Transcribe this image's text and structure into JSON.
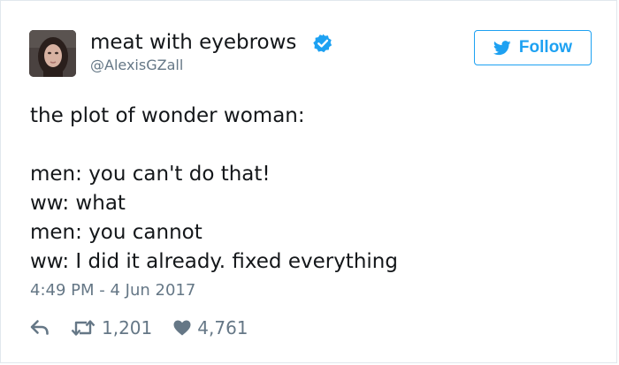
{
  "tweet": {
    "author": {
      "display_name": "meat with eyebrows",
      "handle": "@AlexisGZall",
      "verified": true,
      "avatar_icon": "profile-photo"
    },
    "follow_button": {
      "label": "Follow",
      "icon": "twitter-bird-icon"
    },
    "text_lines": [
      "the plot of wonder woman:",
      "",
      "men: you can't do that!",
      "ww: what",
      "men: you cannot",
      "ww: I did it already. fixed everything"
    ],
    "timestamp": "4:49 PM - 4 Jun 2017",
    "actions": {
      "reply": {
        "icon": "reply-icon"
      },
      "retweet": {
        "icon": "retweet-icon",
        "count": "1,201"
      },
      "like": {
        "icon": "heart-icon",
        "count": "4,761"
      }
    }
  },
  "colors": {
    "accent": "#1da1f2",
    "verified": "#1da1f2",
    "text_primary": "#14171a",
    "text_secondary": "#657786",
    "border": "#e1e8ed"
  }
}
